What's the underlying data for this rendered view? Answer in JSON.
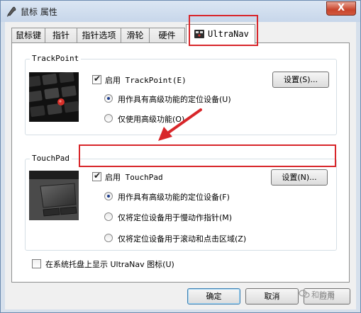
{
  "window": {
    "title": "鼠标 属性",
    "close_label": "X"
  },
  "tabs": [
    {
      "label": "鼠标键"
    },
    {
      "label": "指针"
    },
    {
      "label": "指针选项"
    },
    {
      "label": "滑轮"
    },
    {
      "label": "硬件"
    },
    {
      "label": "UltraNav",
      "active": true
    }
  ],
  "trackpoint": {
    "group_label": "TrackPoint",
    "enable_label": "启用 TrackPoint(E)",
    "enabled": true,
    "settings_label": "设置(S)...",
    "options": [
      {
        "label": "用作具有高级功能的定位设备(U)",
        "selected": true
      },
      {
        "label": "仅使用高级功能(O)",
        "selected": false
      }
    ]
  },
  "touchpad": {
    "group_label": "TouchPad",
    "enable_label": "启用 TouchPad",
    "enabled": true,
    "settings_label": "设置(N)...",
    "options": [
      {
        "label": "用作具有高级功能的定位设备(F)",
        "selected": true
      },
      {
        "label": "仅将定位设备用于慢动作指针(M)",
        "selected": false
      },
      {
        "label": "仅将定位设备用于滚动和点击区域(Z)",
        "selected": false
      }
    ]
  },
  "tray_option": {
    "label": "在系统托盘上显示 UltraNav 图标(U)",
    "checked": false
  },
  "footer": {
    "ok_label": "确定",
    "cancel_label": "取消",
    "apply_label": "应用"
  },
  "watermark": {
    "text": "和韵哥"
  },
  "colors": {
    "annotation": "#d8262a",
    "titlebar": "#c7d6ea",
    "panel": "#ffffff"
  }
}
